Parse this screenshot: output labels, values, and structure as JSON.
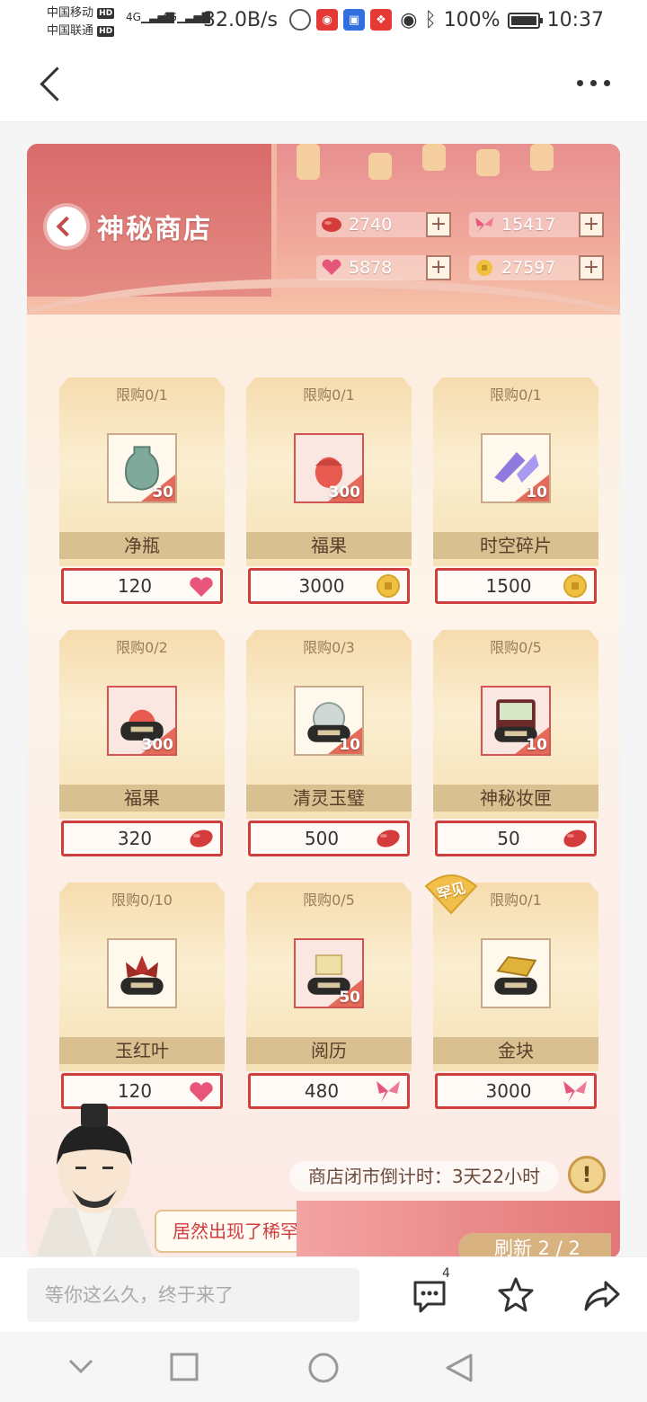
{
  "status_bar": {
    "carrier_1": "中国移动",
    "carrier_2": "中国联通",
    "hd": "HD",
    "net_1": "4G",
    "net_2": "4G",
    "speed": "32.0B/s",
    "battery": "100%",
    "time": "10:37"
  },
  "shop": {
    "title": "神秘商店",
    "currencies": [
      {
        "icon": "red-bean-icon",
        "value": "2740",
        "color": "#d43b3b"
      },
      {
        "icon": "butterfly-icon",
        "value": "15417",
        "color": "#e8557a"
      },
      {
        "icon": "heart-icon",
        "value": "5878",
        "color": "#e8557a"
      },
      {
        "icon": "coin-icon",
        "value": "27597",
        "color": "#f0c040"
      }
    ],
    "plus_label": "+",
    "items": [
      {
        "limit": "限购0/1",
        "name": "净瓶",
        "qty": "50",
        "price": "120",
        "currency_icon": "heart-icon"
      },
      {
        "limit": "限购0/1",
        "name": "福果",
        "qty": "300",
        "price": "3000",
        "currency_icon": "coin-icon"
      },
      {
        "limit": "限购0/1",
        "name": "时空碎片",
        "qty": "10",
        "price": "1500",
        "currency_icon": "coin-icon"
      },
      {
        "limit": "限购0/2",
        "name": "福果",
        "qty": "300",
        "price": "320",
        "currency_icon": "red-bean-icon"
      },
      {
        "limit": "限购0/3",
        "name": "清灵玉璧",
        "qty": "10",
        "price": "500",
        "currency_icon": "red-bean-icon"
      },
      {
        "limit": "限购0/5",
        "name": "神秘妆匣",
        "qty": "10",
        "price": "50",
        "currency_icon": "red-bean-icon"
      },
      {
        "limit": "限购0/10",
        "name": "玉红叶",
        "qty": "",
        "price": "120",
        "currency_icon": "heart-icon"
      },
      {
        "limit": "限购0/5",
        "name": "阅历",
        "qty": "50",
        "price": "480",
        "currency_icon": "butterfly-icon"
      },
      {
        "limit": "限购0/1",
        "name": "金块",
        "qty": "",
        "price": "3000",
        "currency_icon": "butterfly-icon",
        "badge": "罕见"
      }
    ],
    "countdown": "商店闭市倒计时：3天22小时",
    "alert": "!",
    "npc_speech": "居然出现了稀罕货！",
    "refresh": "刷新 2 / 2"
  },
  "bottom_bar": {
    "comment_placeholder": "等你这么久，终于来了",
    "comment_count": "4"
  }
}
